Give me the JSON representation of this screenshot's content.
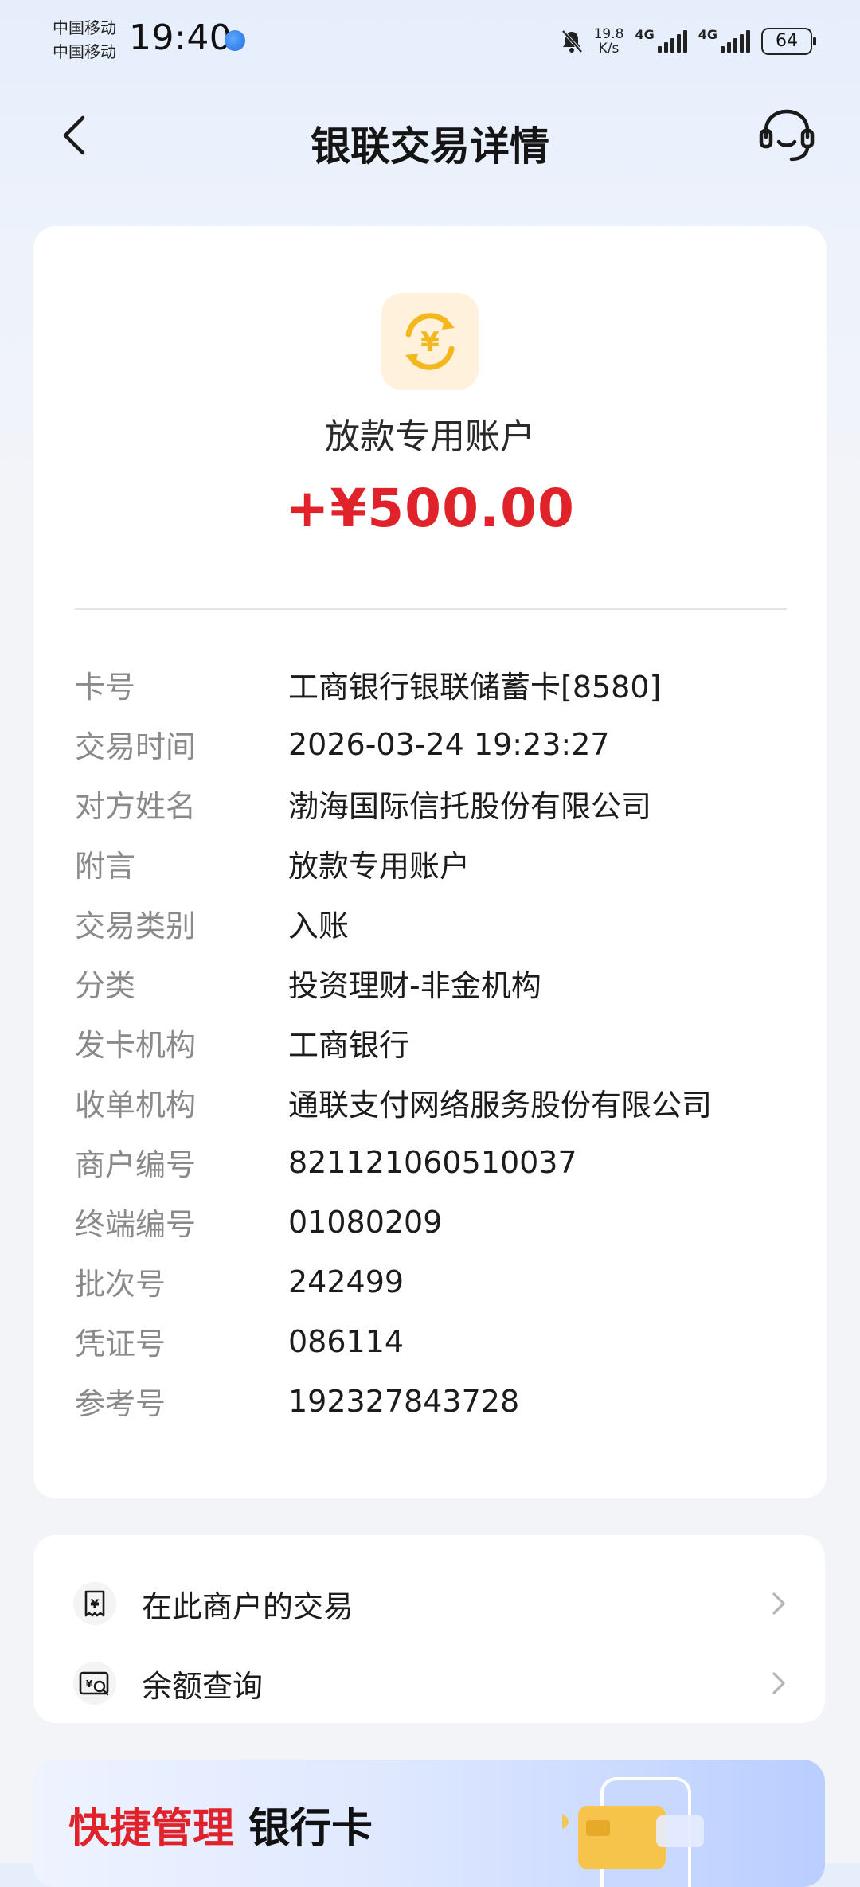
{
  "status_bar": {
    "carrier_1": "中国移动",
    "carrier_2": "中国移动",
    "time": "19:40",
    "net_speed_value": "19.8",
    "net_speed_unit": "K/s",
    "network_1": "4G",
    "network_2": "4G",
    "battery": "64"
  },
  "header": {
    "title": "银联交易详情",
    "back_icon": "chevron-left-icon",
    "service_icon": "headset-icon"
  },
  "transaction": {
    "icon": "yuan-exchange-icon",
    "payer_name": "放款专用账户",
    "amount": "+¥500.00",
    "amount_color": "#e0232b",
    "details": [
      {
        "label": "卡号",
        "value": "工商银行银联储蓄卡[8580]"
      },
      {
        "label": "交易时间",
        "value": "2026-03-24 19:23:27"
      },
      {
        "label": "对方姓名",
        "value": "渤海国际信托股份有限公司"
      },
      {
        "label": "附言",
        "value": "放款专用账户"
      },
      {
        "label": "交易类别",
        "value": "入账"
      },
      {
        "label": "分类",
        "value": "投资理财-非金机构"
      },
      {
        "label": "发卡机构",
        "value": "工商银行"
      },
      {
        "label": "收单机构",
        "value": "通联支付网络服务股份有限公司"
      },
      {
        "label": "商户编号",
        "value": "821121060510037"
      },
      {
        "label": "终端编号",
        "value": "01080209"
      },
      {
        "label": "批次号",
        "value": "242499"
      },
      {
        "label": "凭证号",
        "value": "086114"
      },
      {
        "label": "参考号",
        "value": "192327843728"
      }
    ]
  },
  "links": [
    {
      "label": "在此商户的交易",
      "icon": "receipt-yuan-icon"
    },
    {
      "label": "余额查询",
      "icon": "balance-search-icon"
    }
  ],
  "banner": {
    "highlight": "快捷管理",
    "text": "银行卡"
  }
}
